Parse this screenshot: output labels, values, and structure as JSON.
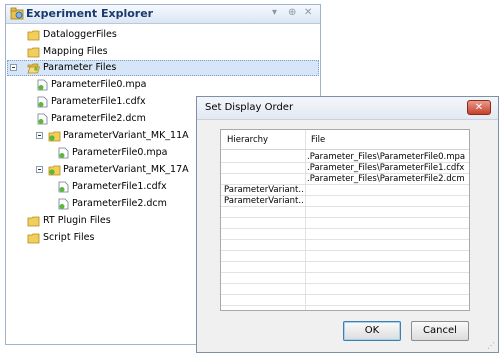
{
  "explorer": {
    "title": "Experiment Explorer",
    "controls": [
      "▾",
      "⊕",
      "✕"
    ],
    "items": [
      {
        "label": "DataloggerFiles",
        "icon": "folder-icon"
      },
      {
        "label": "Mapping Files",
        "icon": "folder-icon"
      },
      {
        "label": "Parameter Files",
        "icon": "folder-open-icon",
        "expanded": true,
        "selected": true
      },
      {
        "label": "ParameterFile0.mpa",
        "icon": "parameter-file-icon"
      },
      {
        "label": "ParameterFile1.cdfx",
        "icon": "parameter-file-icon"
      },
      {
        "label": "ParameterFile2.dcm",
        "icon": "parameter-file-icon"
      },
      {
        "label": "ParameterVariant_MK_11A",
        "icon": "variant-folder-icon",
        "expanded": true
      },
      {
        "label": "ParameterFile0.mpa",
        "icon": "parameter-file-icon"
      },
      {
        "label": "ParameterVariant_MK_17A",
        "icon": "variant-folder-icon",
        "expanded": true
      },
      {
        "label": "ParameterFile1.cdfx",
        "icon": "parameter-file-icon"
      },
      {
        "label": "ParameterFile2.dcm",
        "icon": "parameter-file-icon"
      },
      {
        "label": "RT Plugin Files",
        "icon": "folder-icon"
      },
      {
        "label": "Script Files",
        "icon": "folder-icon"
      }
    ]
  },
  "dialog": {
    "title": "Set Display Order",
    "close": "✕",
    "columns": [
      "Hierarchy",
      "File"
    ],
    "rows": [
      {
        "hierarchy": "",
        "file": ".Parameter_Files\\ParameterFile0.mpa"
      },
      {
        "hierarchy": "",
        "file": ".Parameter_Files\\ParameterFile1.cdfx"
      },
      {
        "hierarchy": "",
        "file": ".Parameter_Files\\ParameterFile2.dcm"
      },
      {
        "hierarchy": "ParameterVariant...",
        "file": ""
      },
      {
        "hierarchy": "ParameterVariant...",
        "file": ""
      }
    ],
    "ok_label": "OK",
    "cancel_label": "Cancel"
  }
}
